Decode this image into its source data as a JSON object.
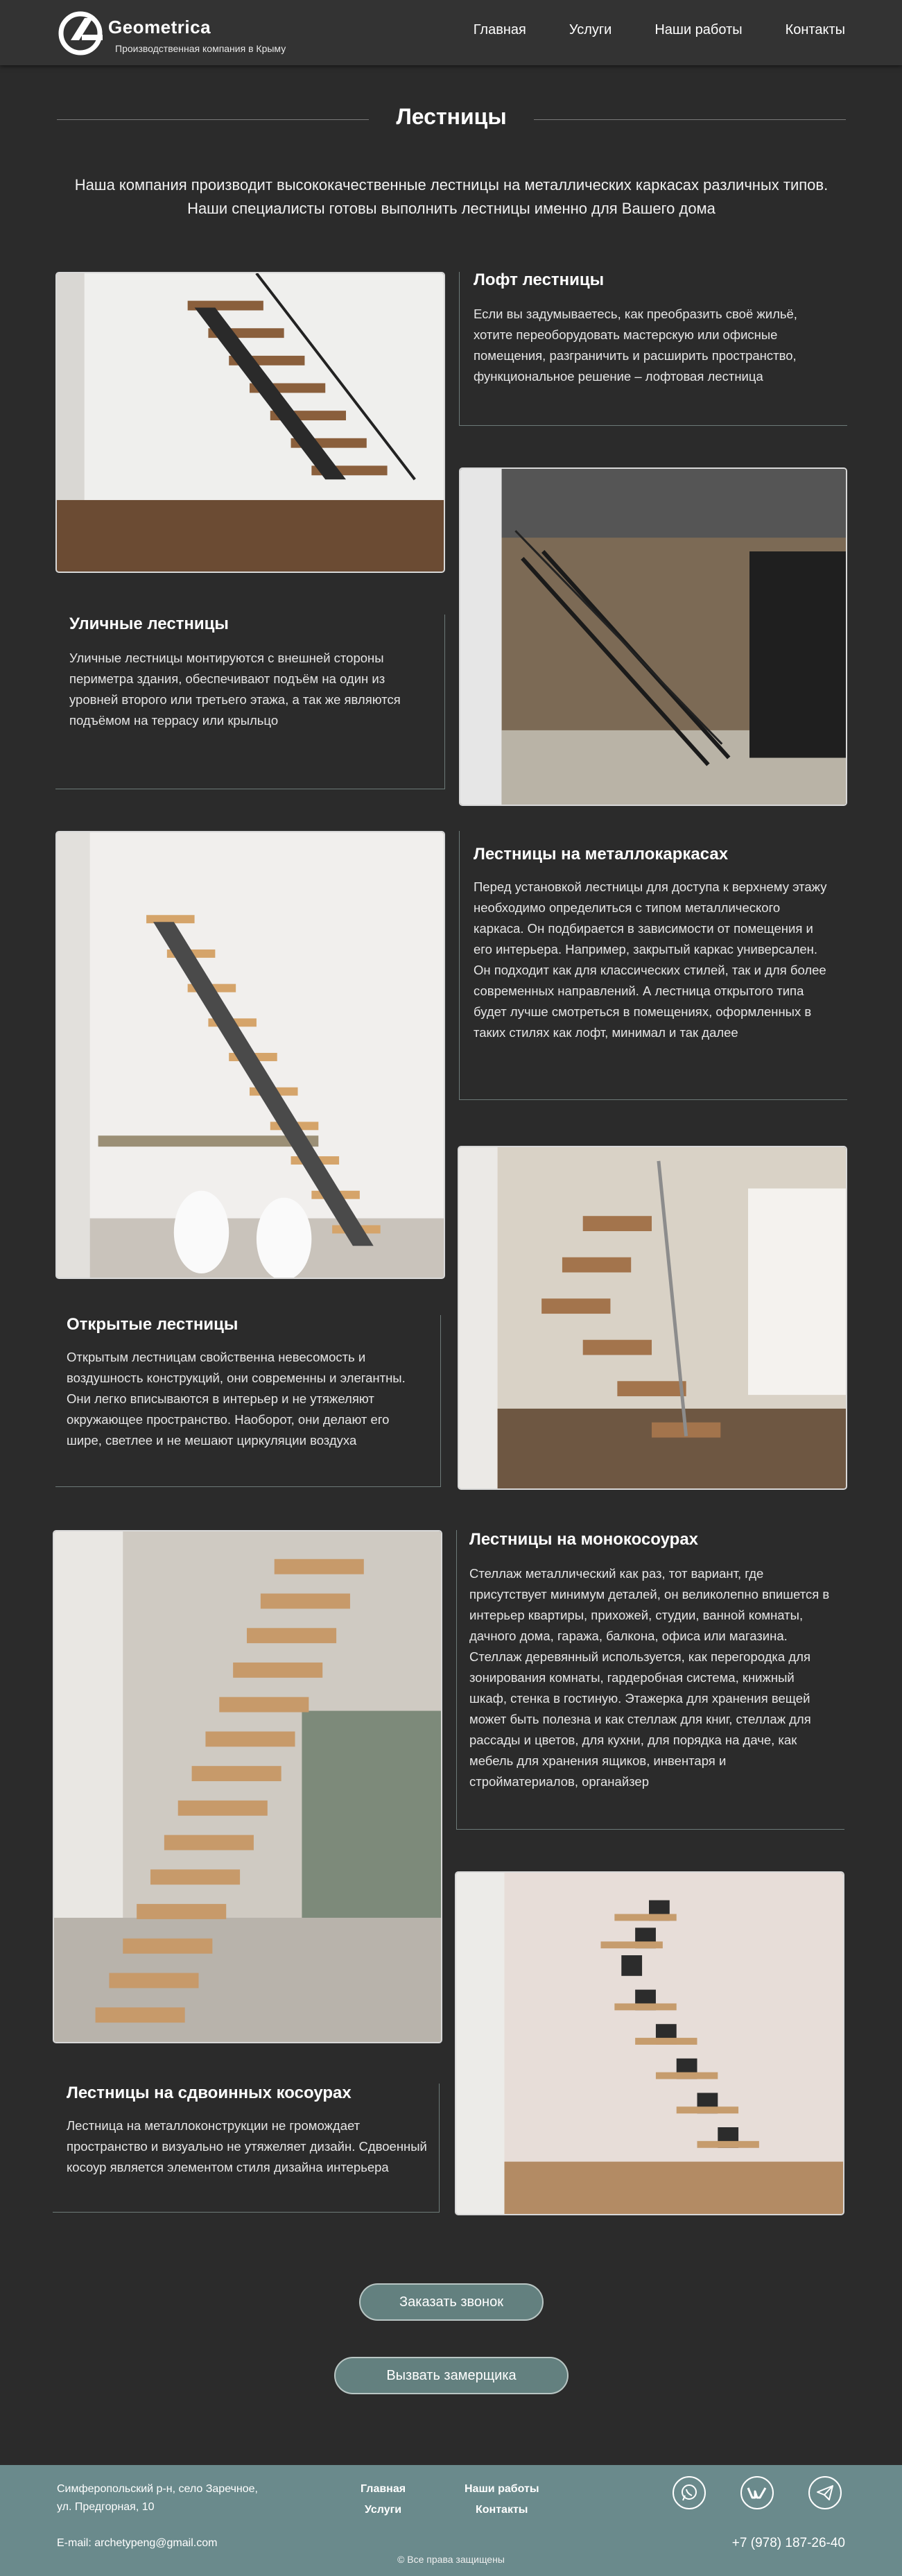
{
  "header": {
    "brand": "Geometrica",
    "tagline": "Производственная компания в Крыму",
    "nav": [
      "Главная",
      "Услуги",
      "Наши работы",
      "Контакты"
    ]
  },
  "page": {
    "title": "Лестницы",
    "intro": "Наша компания производит высококачественные лестницы на металлических каркасах различных типов. Наши специалисты готовы выполнить лестницы именно для Вашего дома"
  },
  "sections": [
    {
      "title": "Лофт лестницы",
      "text": "Если вы задумываетесь, как преобразить своё жильё, хотите переоборудовать мастерскую или офисные помещения, разграничить и расширить пространство, функциональное решение – лофтовая лестница"
    },
    {
      "title": "Уличные лестницы",
      "text": "Уличные лестницы монтируются с внешней стороны периметра здания, обеспечивают подъём на один из уровней второго или третьего этажа, а так же являются подъёмом на террасу или крыльцо"
    },
    {
      "title": "Лестницы на металлокаркасах",
      "text": "Перед установкой лестницы для доступа к верхнему этажу необходимо определиться с типом металлического каркаса. Он подбирается в зависимости от помещения и его интерьера. Например, закрытый каркас универсален. Он подходит  как для классических стилей, так и для более современных направлений. А лестница открытого типа будет лучше  смотреться в помещениях, оформленных в таких стилях как лофт, минимал и так далее"
    },
    {
      "title": "Открытые лестницы",
      "text": "Открытым лестницам свойственна невесомость и воздушность конструкций, они современны и элегантны. Они легко вписываются в интерьер и не утяжеляют окружающее пространство. Наоборот, они делают его шире, светлее и не мешают циркуляции воздуха"
    },
    {
      "title": "Лестницы на монокосоурах",
      "text": "Стеллаж металлический как раз, тот вариант, где присутствует минимум деталей, он великолепно впишется в интерьер квартиры, прихожей, студии, ванной комнаты, дачного дома, гаража, балкона, офиса или магазина. Стеллаж деревянный используется, как перегородка для зонирования комнаты, гардеробная система, книжный шкаф, стенка в гостиную. Этажерка для хранения вещей может быть полезна и как стеллаж для книг, стеллаж для рассады и цветов, для кухни, для порядка на даче, как мебель для хранения ящиков, инвентаря и стройматериалов, органайзер"
    },
    {
      "title": "Лестницы на сдвоинных косоурах",
      "text": "Лестница на металлоконструкции не громождает пространство и визуально не утяжеляет дизайн. Сдвоенный косоур является элементом стиля дизайна интерьера"
    }
  ],
  "buttons": {
    "call": "Заказать звонок",
    "measure": "Вызвать замерщика"
  },
  "footer": {
    "address_line1": "Симферопольский р-н, село Заречное,",
    "address_line2": "ул. Предгорная, 10",
    "email": "E-mail: archetypeng@gmail.com",
    "nav": [
      "Главная",
      "Наши работы",
      "Услуги",
      "Контакты"
    ],
    "phone": "+7 (978) 187-26-40",
    "copyright": "© Все права защищены"
  },
  "icons": [
    "logo-icon",
    "whatsapp-icon",
    "vk-icon",
    "telegram-icon"
  ],
  "colors": {
    "background": "#2b2b2b",
    "header": "#333333",
    "footer": "#6a8a8c",
    "button": "#63807f"
  }
}
